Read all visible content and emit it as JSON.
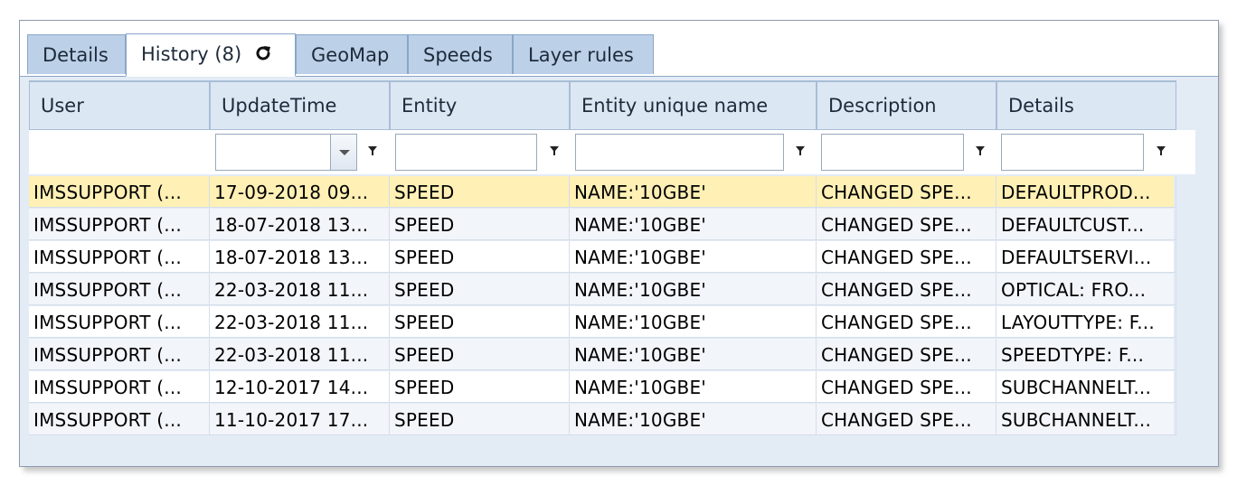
{
  "tabs": [
    {
      "label": "Details"
    },
    {
      "label": "History (8)",
      "active": true,
      "icon": "refresh-icon"
    },
    {
      "label": "GeoMap"
    },
    {
      "label": "Speeds"
    },
    {
      "label": "Layer rules"
    }
  ],
  "grid": {
    "columns": [
      "User",
      "UpdateTime",
      "Entity",
      "Entity unique name",
      "Description",
      "Details"
    ],
    "filters": [
      "",
      "",
      "",
      "",
      "",
      ""
    ],
    "rows": [
      [
        "IMSSUPPORT (...",
        "17-09-2018 09...",
        "SPEED",
        "NAME:'10GBE'",
        "CHANGED SPE...",
        "DEFAULTPROD..."
      ],
      [
        "IMSSUPPORT (...",
        "18-07-2018 13...",
        "SPEED",
        "NAME:'10GBE'",
        "CHANGED SPE...",
        "DEFAULTCUST..."
      ],
      [
        "IMSSUPPORT (...",
        "18-07-2018 13...",
        "SPEED",
        "NAME:'10GBE'",
        "CHANGED SPE...",
        "DEFAULTSERVI..."
      ],
      [
        "IMSSUPPORT (...",
        "22-03-2018 11...",
        "SPEED",
        "NAME:'10GBE'",
        "CHANGED SPE...",
        "OPTICAL: FRO..."
      ],
      [
        "IMSSUPPORT (...",
        "22-03-2018 11...",
        "SPEED",
        "NAME:'10GBE'",
        "CHANGED SPE...",
        "LAYOUTTYPE: F..."
      ],
      [
        "IMSSUPPORT (...",
        "22-03-2018 11...",
        "SPEED",
        "NAME:'10GBE'",
        "CHANGED SPE...",
        "SPEEDTYPE: F..."
      ],
      [
        "IMSSUPPORT (...",
        "12-10-2017 14...",
        "SPEED",
        "NAME:'10GBE'",
        "CHANGED SPE...",
        "SUBCHANNELT..."
      ],
      [
        "IMSSUPPORT (...",
        "11-10-2017 17...",
        "SPEED",
        "NAME:'10GBE'",
        "CHANGED SPE...",
        "SUBCHANNELT..."
      ]
    ]
  }
}
